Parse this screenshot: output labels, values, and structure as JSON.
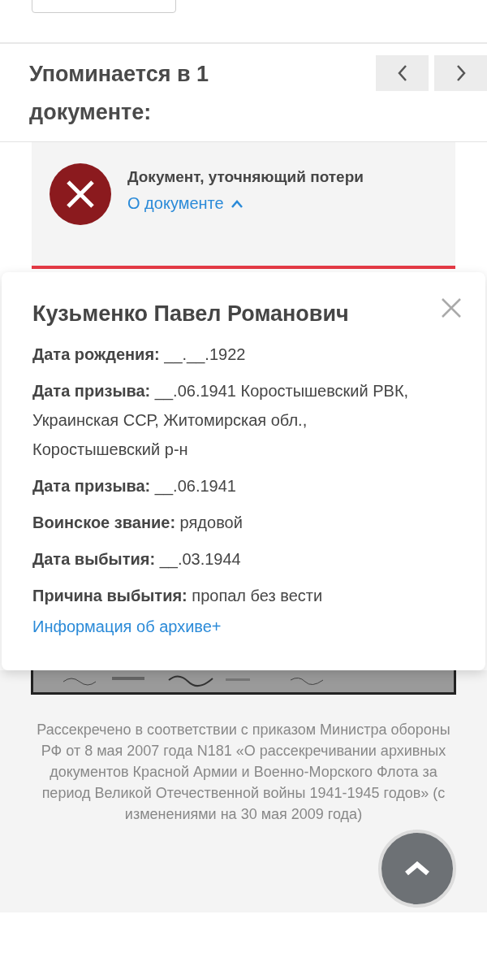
{
  "section_title": "Упоминается в 1 документе:",
  "nav": [
    {
      "kind": "prev"
    },
    {
      "kind": "next"
    }
  ],
  "document": {
    "title": "Документ, уточняющий потери",
    "toggle": "О документе",
    "expanded": true
  },
  "person": {
    "name": "Кузьменко Павел Романович",
    "fields": [
      {
        "label": "Дата рождения:",
        "value": "__.__.1922"
      },
      {
        "label": "Дата призыва:",
        "value": "__.06.1941 Коростышевский РВК, Украинская ССР, Житомирская обл., Коростышевский р-н"
      },
      {
        "label": "Дата призыва:",
        "value": "__.06.1941"
      },
      {
        "label": "Воинское звание:",
        "value": "рядовой"
      },
      {
        "label": "Дата выбытия:",
        "value": "__.03.1944"
      },
      {
        "label": "Причина выбытия:",
        "value": "пропал без вести"
      }
    ],
    "archive_link": "Информация об архиве+"
  },
  "footnote": "Рассекречено в соответствии с приказом Министра обороны РФ от 8 мая 2007 года N181 «О рассекречивании архивных документов Красной Армии и Военно-Морского Флота за период Великой Отечественной войны 1941-1945 годов» (с изменениями на 30 мая 2009 года)"
}
